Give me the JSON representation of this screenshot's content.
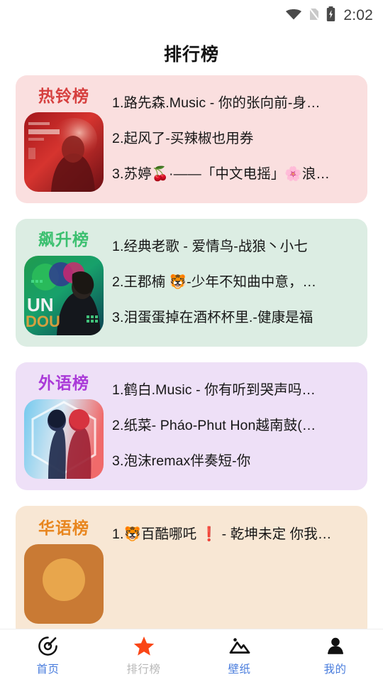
{
  "status_bar": {
    "wifi_icon": "wifi-icon",
    "sim_icon": "no-sim-icon",
    "battery_icon": "battery-charging-icon",
    "time": "2:02"
  },
  "header": {
    "title": "排行榜"
  },
  "charts": [
    {
      "id": "hot-ringtone",
      "title": "热铃榜",
      "title_color": "#d6403f",
      "bg_color": "#fadfdf",
      "thumb_name": "album-cover-red-portrait",
      "songs": [
        "1.路先森.Music - 你的张向前-身…",
        "2.起风了-买辣椒也用券",
        "3.苏婷🍒·——「中文电摇」🌸浪…"
      ]
    },
    {
      "id": "rising",
      "title": "飙升榜",
      "title_color": "#3cc070",
      "bg_color": "#dcede3",
      "thumb_name": "album-cover-green-portrait",
      "songs": [
        "1.经典老歌 - 爱情鸟-战狼丶小七",
        "2.王郡楠 🐯-少年不知曲中意，…",
        "3.泪蛋蛋掉在酒杯杯里.-健康是福"
      ]
    },
    {
      "id": "foreign-language",
      "title": "外语榜",
      "title_color": "#aa3ad8",
      "bg_color": "#eee0f7",
      "thumb_name": "album-cover-blue-red-duo",
      "songs": [
        "1.鹤白.Music - 你有听到哭声吗…",
        "2.纸菜- Pháo-Phut Hon越南鼓(…",
        "3.泡沫remax伴奏短-你"
      ]
    },
    {
      "id": "chinese",
      "title": "华语榜",
      "title_color": "#e8861f",
      "bg_color": "#f8e7d4",
      "thumb_name": "album-cover-chinese",
      "songs": [
        "1.🐯百酷哪吒 ❗ - 乾坤未定 你我…"
      ]
    }
  ],
  "bottom_nav": {
    "items": [
      {
        "label": "首页",
        "icon": "compass-icon",
        "active": false
      },
      {
        "label": "排行榜",
        "icon": "star-icon",
        "active": true
      },
      {
        "label": "壁纸",
        "icon": "image-mountain-icon",
        "active": false
      },
      {
        "label": "我的",
        "icon": "person-icon",
        "active": false
      }
    ],
    "active_icon_color": "#fa4616",
    "inactive_label_color": "#4a7ddd",
    "active_label_color": "#b7b7b7"
  }
}
